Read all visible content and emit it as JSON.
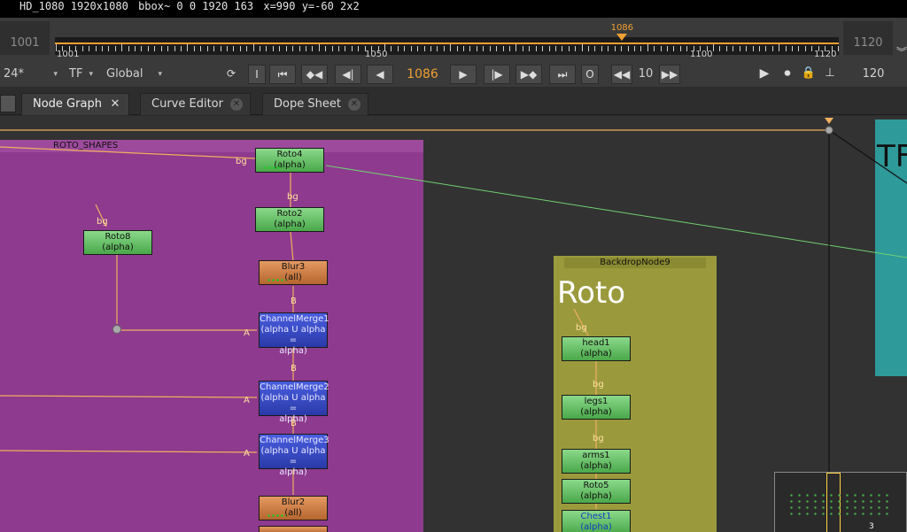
{
  "info": {
    "format": "HD_1080 1920x1080",
    "bbox": "bbox~ 0 0 1920 163",
    "coords": "x=990 y=-60 2x2"
  },
  "timeline": {
    "start": "1001",
    "end": "1120",
    "ruler_start": "1001",
    "ruler_mid1": "1050",
    "ruler_mid2": "1100",
    "ruler_end": "1120",
    "current": "1086",
    "playhead_fraction": 0.7227
  },
  "transport": {
    "fps": "24*",
    "tf": "TF",
    "scope": "Global",
    "frame": "1086",
    "inc": "10",
    "end_frame": "120",
    "buttons": {
      "in": "I",
      "out": "O"
    }
  },
  "tabs": [
    {
      "label": "Node Graph",
      "active": true
    },
    {
      "label": "Curve Editor",
      "active": false
    },
    {
      "label": "Dope Sheet",
      "active": false
    }
  ],
  "backdrops": {
    "roto_shapes": {
      "title": "ROTO_SHAPES",
      "color": "#8e3a8e"
    },
    "backdrop9": {
      "title": "BackdropNode9",
      "big": "Roto",
      "color": "#9a9a3c"
    },
    "teal": {
      "big": "TF",
      "color": "#2e9a9a"
    }
  },
  "nodes": {
    "roto4": {
      "name": "Roto4",
      "channel": "(alpha)"
    },
    "roto2": {
      "name": "Roto2",
      "channel": "(alpha)"
    },
    "roto8": {
      "name": "Roto8",
      "channel": "(alpha)"
    },
    "blur3": {
      "name": "Blur3",
      "channel": "(all)"
    },
    "cm1": {
      "name": "ChannelMerge1",
      "channel": "(alpha U alpha =",
      "channel2": "alpha)"
    },
    "cm2": {
      "name": "ChannelMerge2",
      "channel": "(alpha U alpha =",
      "channel2": "alpha)"
    },
    "cm3": {
      "name": "ChannelMerge3",
      "channel": "(alpha U alpha =",
      "channel2": "alpha)"
    },
    "blur2": {
      "name": "Blur2",
      "channel": "(all)"
    },
    "head1": {
      "name": "head1",
      "channel": "(alpha)"
    },
    "legs1": {
      "name": "legs1",
      "channel": "(alpha)"
    },
    "arms1": {
      "name": "arms1",
      "channel": "(alpha)"
    },
    "roto5": {
      "name": "Roto5",
      "channel": "(alpha)"
    },
    "chest1": {
      "name": "Chest1",
      "channel": "(alpha)"
    }
  },
  "pins": {
    "bg": "bg",
    "a": "A",
    "b": "B"
  },
  "minimap": {
    "label": "3"
  }
}
